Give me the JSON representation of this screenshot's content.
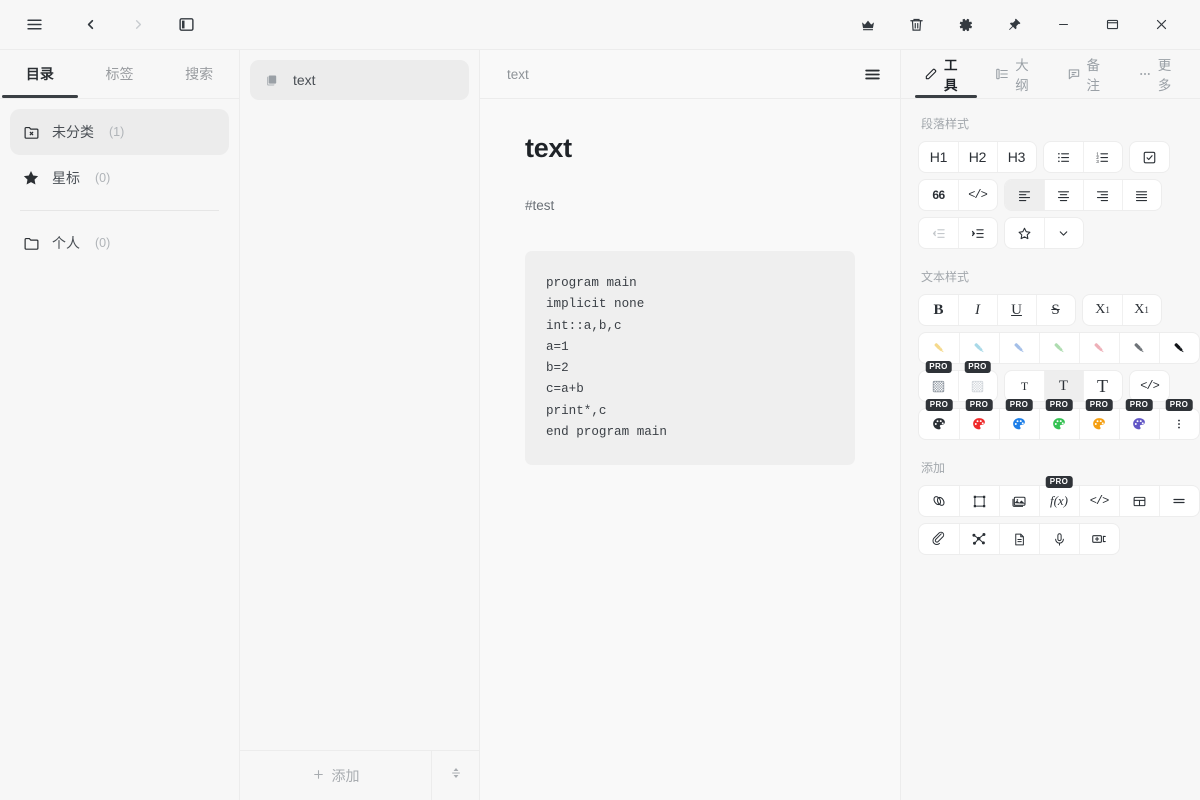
{
  "titlebar": {
    "left_buttons": [
      {
        "name": "menu-icon",
        "label": "菜单"
      },
      {
        "name": "back-icon",
        "label": "后退"
      },
      {
        "name": "forward-icon",
        "label": "前进"
      },
      {
        "name": "toggle-sidebar-icon",
        "label": "侧边栏"
      }
    ],
    "right_buttons": [
      {
        "name": "crown-icon",
        "label": "会员"
      },
      {
        "name": "trash-icon",
        "label": "回收站"
      },
      {
        "name": "gear-icon",
        "label": "设置"
      },
      {
        "name": "pin-icon",
        "label": "置顶"
      },
      {
        "name": "minimize-icon",
        "label": "最小化"
      },
      {
        "name": "maximize-icon",
        "label": "最大化"
      },
      {
        "name": "close-icon",
        "label": "关闭"
      }
    ]
  },
  "sidebar": {
    "tabs": [
      {
        "label": "目录",
        "active": true
      },
      {
        "label": "标签",
        "active": false
      },
      {
        "label": "搜索",
        "active": false
      }
    ],
    "items": [
      {
        "label": "未分类",
        "count": "(1)",
        "icon": "uncategorized-folder-icon",
        "active": true
      },
      {
        "label": "星标",
        "count": "(0)",
        "icon": "star-icon",
        "active": false
      }
    ],
    "groups": [
      {
        "label": "个人",
        "count": "(0)",
        "icon": "folder-icon",
        "active": false
      }
    ]
  },
  "notelist": {
    "notes": [
      {
        "title": "text",
        "icon": "note-icon",
        "active": true
      }
    ],
    "add_label": "添加",
    "add_icon": "plus-icon",
    "sort_icon": "sort-icon"
  },
  "editor": {
    "breadcrumb": "text",
    "menu_icon": "list-menu-icon",
    "doc_title": "text",
    "doc_tag": "#test",
    "code": "program main\nimplicit none\nint::a,b,c\na=1\nb=2\nc=a+b\nprint*,c\nend program main"
  },
  "inspector": {
    "tabs": [
      {
        "label": "工具",
        "icon": "edit-pencil-icon",
        "active": true
      },
      {
        "label": "大纲",
        "icon": "outline-icon",
        "active": false
      },
      {
        "label": "备注",
        "icon": "comment-icon",
        "active": false
      },
      {
        "label": "更多",
        "icon": "ellipsis-icon",
        "active": false
      }
    ],
    "sections": {
      "paragraph": {
        "label": "段落样式",
        "row1": [
          {
            "name": "heading-1-button",
            "label": "H1"
          },
          {
            "name": "heading-2-button",
            "label": "H2"
          },
          {
            "name": "heading-3-button",
            "label": "H3"
          },
          {
            "name": "bullet-list-button",
            "label": ""
          },
          {
            "name": "numbered-list-button",
            "label": ""
          },
          {
            "name": "checklist-button",
            "label": ""
          }
        ],
        "row2": [
          {
            "name": "blockquote-button",
            "label": "66"
          },
          {
            "name": "code-block-button",
            "label": "</>"
          },
          {
            "name": "align-left-button",
            "label": ""
          },
          {
            "name": "align-center-button",
            "label": ""
          },
          {
            "name": "align-right-button",
            "label": ""
          },
          {
            "name": "align-justify-button",
            "label": ""
          }
        ],
        "row3": [
          {
            "name": "outdent-button",
            "label": ""
          },
          {
            "name": "indent-button",
            "label": ""
          },
          {
            "name": "favorite-style-button",
            "label": ""
          },
          {
            "name": "style-dropdown-button",
            "label": ""
          }
        ]
      },
      "text": {
        "label": "文本样式",
        "row1": [
          {
            "name": "bold-button",
            "label": "B"
          },
          {
            "name": "italic-button",
            "label": "I"
          },
          {
            "name": "underline-button",
            "label": "U"
          },
          {
            "name": "strikethrough-button",
            "label": "S"
          },
          {
            "name": "subscript-button",
            "label": "X1"
          },
          {
            "name": "superscript-button",
            "label": "X1"
          }
        ],
        "highlighters": [
          {
            "name": "highlight-yellow-button",
            "color": "#f5d98c"
          },
          {
            "name": "highlight-cyan-button",
            "color": "#a9d9e8"
          },
          {
            "name": "highlight-blue-button",
            "color": "#a4bfe8"
          },
          {
            "name": "highlight-green-button",
            "color": "#aedcb0"
          },
          {
            "name": "highlight-pink-button",
            "color": "#eeb0b8"
          },
          {
            "name": "highlight-gray-button",
            "color": "#6e7378"
          },
          {
            "name": "highlight-black-button",
            "color": "#111418"
          }
        ],
        "row3": [
          {
            "name": "text-background-button",
            "label": "",
            "pro": true
          },
          {
            "name": "text-pattern-button",
            "label": "",
            "pro": true
          },
          {
            "name": "font-size-small-button",
            "label": "T"
          },
          {
            "name": "font-size-medium-button",
            "label": "T"
          },
          {
            "name": "font-size-large-button",
            "label": "T"
          },
          {
            "name": "inline-code-button",
            "label": "</>"
          }
        ],
        "palettes": [
          {
            "name": "palette-black-button",
            "color": "#2b3036",
            "pro": true
          },
          {
            "name": "palette-red-button",
            "color": "#ef2b2b",
            "pro": true
          },
          {
            "name": "palette-blue-button",
            "color": "#1e7fe8",
            "pro": true
          },
          {
            "name": "palette-green-button",
            "color": "#36c254",
            "pro": true
          },
          {
            "name": "palette-orange-button",
            "color": "#f5a013",
            "pro": true
          },
          {
            "name": "palette-purple-button",
            "color": "#6257c6",
            "pro": true
          },
          {
            "name": "palette-more-button",
            "color": "#2b3036",
            "pro": true
          }
        ]
      },
      "add": {
        "label": "添加",
        "row1": [
          {
            "name": "insert-link-button",
            "pro": false
          },
          {
            "name": "insert-shape-button",
            "pro": false
          },
          {
            "name": "insert-image-button",
            "pro": false
          },
          {
            "name": "insert-formula-button",
            "label": "f(x)",
            "pro": true
          },
          {
            "name": "insert-code-block-button",
            "label": "</>",
            "pro": false
          },
          {
            "name": "insert-table-button",
            "pro": false
          },
          {
            "name": "insert-divider-button",
            "pro": false
          }
        ],
        "row2": [
          {
            "name": "insert-attachment-button"
          },
          {
            "name": "insert-mindmap-button"
          },
          {
            "name": "insert-file-button"
          },
          {
            "name": "insert-audio-button"
          },
          {
            "name": "insert-video-button"
          }
        ]
      }
    }
  },
  "colors": {
    "window_bg": "#f7f7f7",
    "editor_bg": "#f9f9f9",
    "border": "#ececec",
    "selection": "#ececec",
    "text_primary": "#1f2328",
    "text_muted": "#9aa0a6",
    "code_bg": "#efefef",
    "accent": "#3a3f44"
  }
}
